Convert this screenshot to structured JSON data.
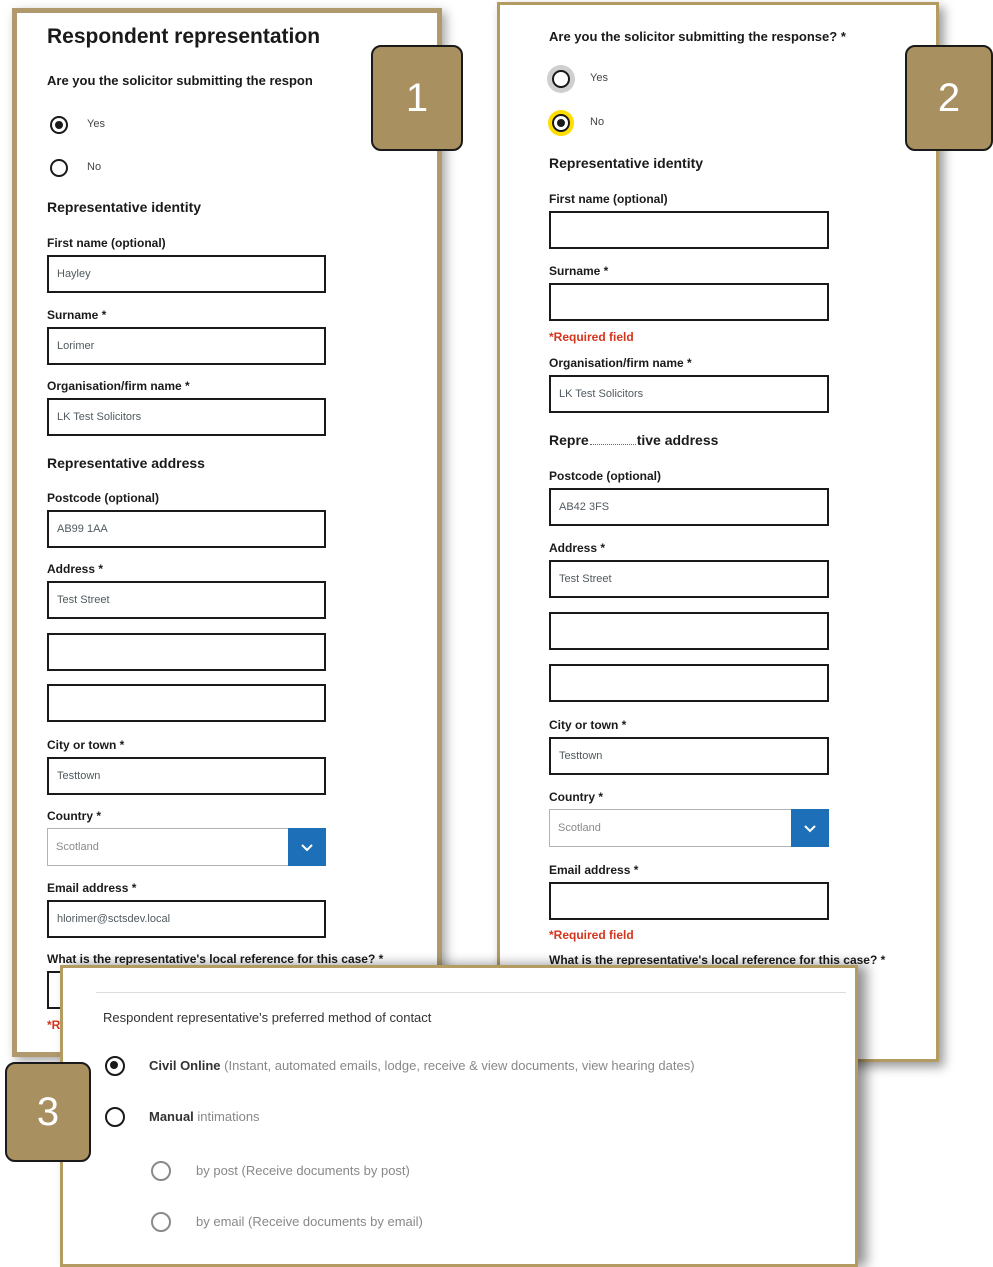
{
  "panel1": {
    "title": "Respondent representation",
    "question": "Are you the solicitor submitting the respon",
    "yes": "Yes",
    "no": "No",
    "identity_heading": "Representative identity",
    "first_name_label": "First name (optional)",
    "first_name_value": "Hayley",
    "surname_label": "Surname *",
    "surname_value": "Lorimer",
    "org_label": "Organisation/firm name *",
    "org_value": "LK Test Solicitors",
    "address_heading": "Representative address",
    "postcode_label": "Postcode (optional)",
    "postcode_value": "AB99 1AA",
    "address_label": "Address *",
    "address_line1": "Test Street",
    "city_label": "City or town *",
    "city_value": "Testtown",
    "country_label": "Country *",
    "country_value": "Scotland",
    "email_label": "Email address *",
    "email_value": "hlorimer@sctsdev.local",
    "reference_label": "What is the representative's local reference for this case? *",
    "required_partial": "*R"
  },
  "panel2": {
    "question": "Are you the solicitor submitting the response? *",
    "yes": "Yes",
    "no": "No",
    "identity_heading": "Representative identity",
    "first_name_label": "First name (optional)",
    "surname_label": "Surname *",
    "required_field": "*Required field",
    "org_label": "Organisation/firm name *",
    "org_value": "LK Test Solicitors",
    "address_heading_start": "Repre",
    "address_heading_end": "tive address",
    "postcode_label": "Postcode (optional)",
    "postcode_value": "AB42 3FS",
    "address_label": "Address *",
    "address_line1": "Test Street",
    "city_label": "City or town *",
    "city_value": "Testtown",
    "country_label": "Country *",
    "country_value": "Scotland",
    "email_label": "Email address *",
    "email_required": "*Required field",
    "reference_label": "What is the representative's local reference for this case? *"
  },
  "panel3": {
    "heading": "Respondent representative's preferred method of contact",
    "civil_online": "Civil Online",
    "civil_online_desc": "(Instant, automated emails, lodge, receive & view documents, view hearing dates)",
    "manual": "Manual",
    "manual_desc": "intimations",
    "by_post": "by post (Receive documents by post)",
    "by_email": "by email (Receive documents by email)"
  },
  "badges": {
    "one": "1",
    "two": "2",
    "three": "3"
  },
  "colors": {
    "frame": "#b09a6d",
    "badge": "#a89060",
    "select_button": "#1d70b8",
    "error": "#d4351c",
    "focus": "#ffdd00"
  },
  "icons": {
    "select_caret": "chevron-down-icon"
  }
}
